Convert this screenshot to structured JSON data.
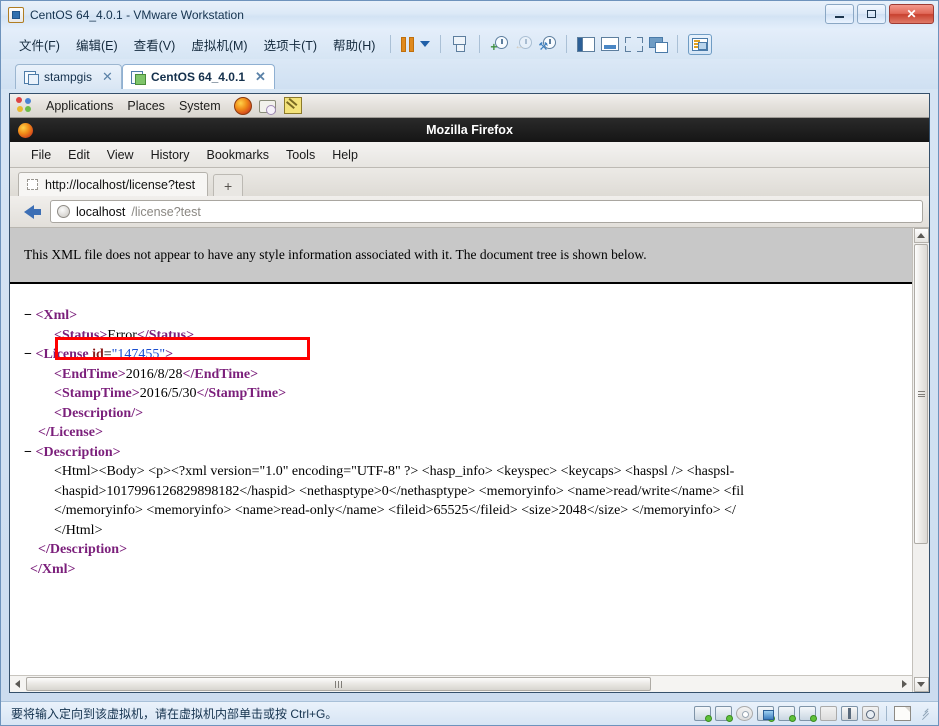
{
  "window": {
    "title": "CentOS 64_4.0.1 - VMware Workstation",
    "icon": "vmware-icon",
    "controls": {
      "minimize": "minimize-button",
      "restore": "restore-button",
      "close": "close-button"
    }
  },
  "menubar": {
    "items": [
      {
        "label": "文件(F)"
      },
      {
        "label": "编辑(E)"
      },
      {
        "label": "查看(V)"
      },
      {
        "label": "虚拟机(M)"
      },
      {
        "label": "选项卡(T)"
      },
      {
        "label": "帮助(H)"
      }
    ]
  },
  "toolbar": {
    "buttons": [
      {
        "name": "pause-vm",
        "label": ""
      },
      {
        "name": "pause-dropdown",
        "label": ""
      },
      {
        "name": "send-ctrl-alt-del",
        "label": ""
      },
      {
        "name": "take-snapshot",
        "label": ""
      },
      {
        "name": "revert-snapshot",
        "label": ""
      },
      {
        "name": "manage-snapshots",
        "label": ""
      },
      {
        "name": "show-library",
        "label": ""
      },
      {
        "name": "console-view",
        "label": ""
      },
      {
        "name": "fullscreen",
        "label": ""
      },
      {
        "name": "multiple-monitors",
        "label": ""
      },
      {
        "name": "library-toggle",
        "label": ""
      }
    ]
  },
  "vm_tabs": [
    {
      "label": "stampgis",
      "active": false,
      "running": false
    },
    {
      "label": "CentOS 64_4.0.1",
      "active": true,
      "running": true
    }
  ],
  "guest": {
    "gnome_panel": {
      "menus": [
        "Applications",
        "Places",
        "System"
      ],
      "launchers": [
        "firefox-icon",
        "email-icon",
        "text-editor-icon"
      ]
    },
    "firefox": {
      "title": "Mozilla Firefox",
      "menubar": [
        "File",
        "Edit",
        "View",
        "History",
        "Bookmarks",
        "Tools",
        "Help"
      ],
      "tab": {
        "title": "http://localhost/license?test",
        "new_tab_label": "+"
      },
      "address": {
        "host": "localhost",
        "path": "/license?test"
      },
      "page": {
        "warning": "This XML file does not appear to have any style information associated with it. The document tree is shown below.",
        "xml_lines": [
          {
            "indent": 0,
            "marker": "−",
            "parts": [
              {
                "t": "tag",
                "v": "<Xml>"
              }
            ]
          },
          {
            "indent": 1,
            "marker": "",
            "parts": [
              {
                "t": "tag",
                "v": "<Status>"
              },
              {
                "t": "txt",
                "v": "Error"
              },
              {
                "t": "tag",
                "v": "</Status>"
              }
            ]
          },
          {
            "indent": 0,
            "marker": "−",
            "parts": [
              {
                "t": "tag",
                "v": "<License "
              },
              {
                "t": "attr-n",
                "v": "id"
              },
              {
                "t": "txt",
                "v": "="
              },
              {
                "t": "attr-v",
                "v": "\"147455\""
              },
              {
                "t": "tag",
                "v": ">"
              }
            ]
          },
          {
            "indent": 1,
            "marker": "",
            "parts": [
              {
                "t": "tag",
                "v": "<EndTime>"
              },
              {
                "t": "txt",
                "v": "2016/8/28"
              },
              {
                "t": "tag",
                "v": "</EndTime>"
              }
            ]
          },
          {
            "indent": 1,
            "marker": "",
            "parts": [
              {
                "t": "tag",
                "v": "<StampTime>"
              },
              {
                "t": "txt",
                "v": "2016/5/30"
              },
              {
                "t": "tag",
                "v": "</StampTime>"
              }
            ]
          },
          {
            "indent": 1,
            "marker": "",
            "parts": [
              {
                "t": "tag",
                "v": "<Description/>"
              }
            ]
          },
          {
            "indent": 0,
            "marker": "",
            "parts": [
              {
                "t": "tag",
                "v": "</License>"
              }
            ]
          },
          {
            "indent": 0,
            "marker": "−",
            "parts": [
              {
                "t": "tag",
                "v": "<Description>"
              }
            ]
          },
          {
            "indent": 1,
            "marker": "",
            "parts": [
              {
                "t": "txt",
                "v": "<Html><Body> <p><?xml version=\"1.0\" encoding=\"UTF-8\" ?> <hasp_info> <keyspec> <keycaps> <haspsl /> <haspsl-"
              }
            ]
          },
          {
            "indent": 1,
            "marker": "",
            "parts": [
              {
                "t": "txt",
                "v": "<haspid>1017996126829898182</haspid> <nethasptype>0</nethasptype> <memoryinfo> <name>read/write</name> <fil"
              }
            ]
          },
          {
            "indent": 1,
            "marker": "",
            "parts": [
              {
                "t": "txt",
                "v": "</memoryinfo> <memoryinfo> <name>read-only</name> <fileid>65525</fileid> <size>2048</size> </memoryinfo> </"
              }
            ]
          },
          {
            "indent": 1,
            "marker": "",
            "parts": [
              {
                "t": "txt",
                "v": "</Html>"
              }
            ]
          },
          {
            "indent": 0,
            "marker": "",
            "parts": [
              {
                "t": "tag",
                "v": "</Description>"
              }
            ]
          },
          {
            "indent": -1,
            "marker": "",
            "parts": [
              {
                "t": "tag",
                "v": "</Xml>"
              }
            ]
          }
        ],
        "highlight": {
          "target_line": "EndTime",
          "color": "#ff0000"
        }
      }
    }
  },
  "statusbar": {
    "message": "要将输入定向到该虚拟机，请在虚拟机内部单击或按 Ctrl+G。",
    "devices": [
      {
        "name": "hard-disk-1-icon",
        "state": "on"
      },
      {
        "name": "hard-disk-2-icon",
        "state": "on"
      },
      {
        "name": "cd-dvd-icon",
        "state": "off"
      },
      {
        "name": "network-adapter-icon",
        "state": "on"
      },
      {
        "name": "printer-icon",
        "state": "on"
      },
      {
        "name": "sound-card-icon",
        "state": "on"
      },
      {
        "name": "display-icon",
        "state": "off"
      },
      {
        "name": "usb-controller-icon",
        "state": "on"
      },
      {
        "name": "camera-icon",
        "state": "off"
      }
    ]
  },
  "colors": {
    "xml_tag": "#7b1f7b",
    "xml_attr_name": "#8a1a1a",
    "xml_attr_value": "#1a4fd0",
    "highlight": "#ff0000",
    "firefox_titlebar": "#151515"
  }
}
